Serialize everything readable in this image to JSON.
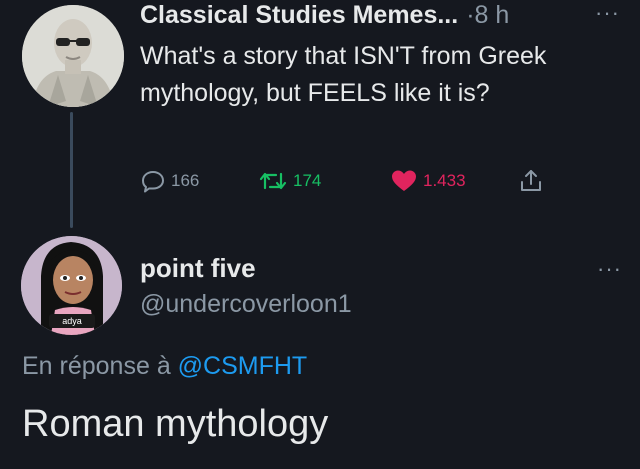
{
  "tweet": {
    "author": "Classical Studies Memes...",
    "time": "·8 h",
    "more": "···",
    "text": "What's a story that ISN'T from Greek mythology, but FEELS like it is?",
    "replies": "166",
    "retweets": "174",
    "likes": "1.433",
    "avatar_icon": "statue-bust-avatar"
  },
  "reply": {
    "name": "point five",
    "handle": "@undercoverloon1",
    "more": "···",
    "in_reply_prefix": "En réponse à",
    "in_reply_mention": "@CSMFHT",
    "text": "Roman mythology",
    "avatar_icon": "cartoon-girl-avatar",
    "avatar_label": "adya"
  },
  "colors": {
    "background": "#15181f",
    "retweet": "#17bf63",
    "like": "#e0245e",
    "link": "#1d9bf0",
    "muted": "#8b98a5"
  }
}
